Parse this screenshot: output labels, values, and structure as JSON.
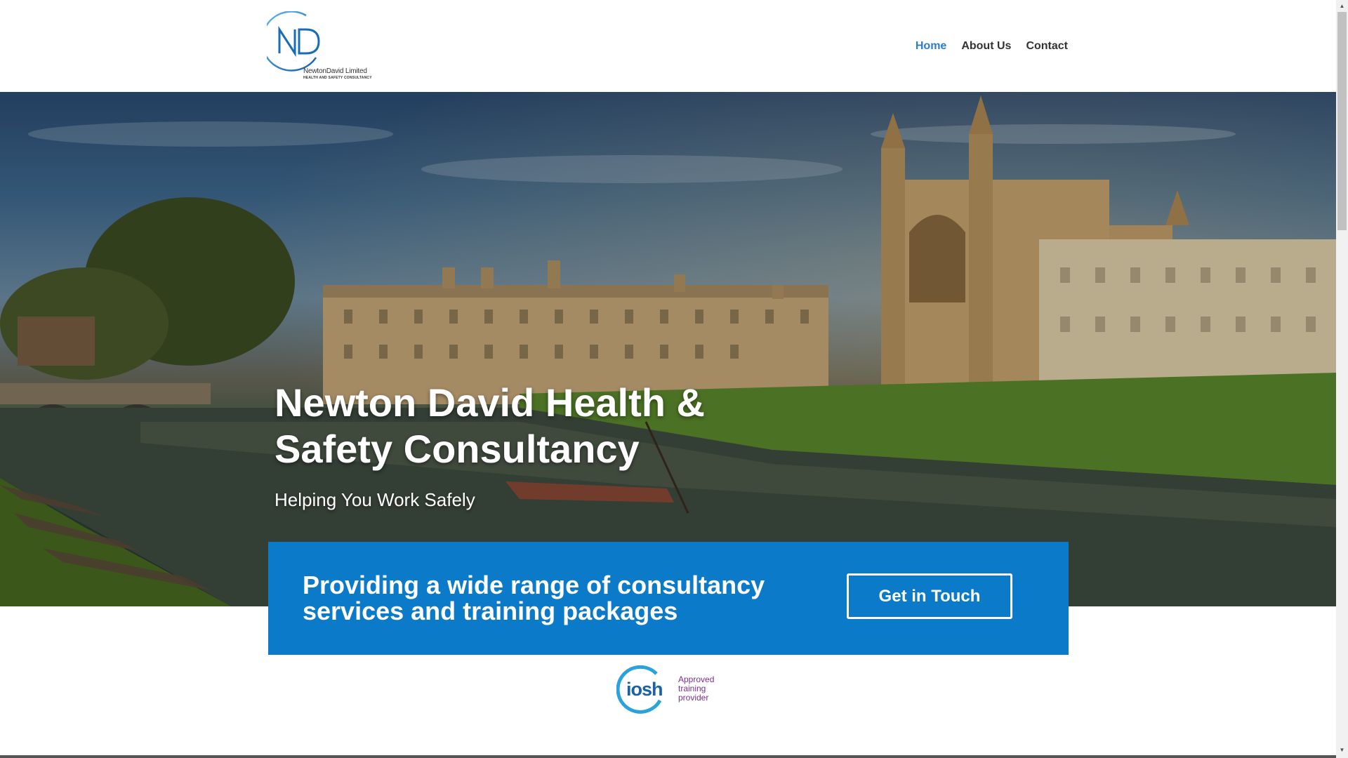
{
  "logo": {
    "monogram": "ND",
    "name": "NewtonDavid Limited",
    "tagline": "HEALTH AND SAFETY CONSULTANCY"
  },
  "nav": {
    "items": [
      {
        "label": "Home",
        "active": true
      },
      {
        "label": "About Us",
        "active": false
      },
      {
        "label": "Contact",
        "active": false
      }
    ]
  },
  "hero": {
    "title": "Newton David Health & Safety Consultancy",
    "subtitle": "Helping You Work Safely"
  },
  "cta": {
    "text": "Providing a wide range of consultancy services and training packages",
    "button_label": "Get in Touch"
  },
  "badge": {
    "word": "iosh",
    "caption_lines": [
      "Approved",
      "training",
      "provider"
    ]
  },
  "colors": {
    "accent": "#0b7ac8",
    "nav_active": "#2a7fc6",
    "badge_purple": "#7a2f8f"
  }
}
